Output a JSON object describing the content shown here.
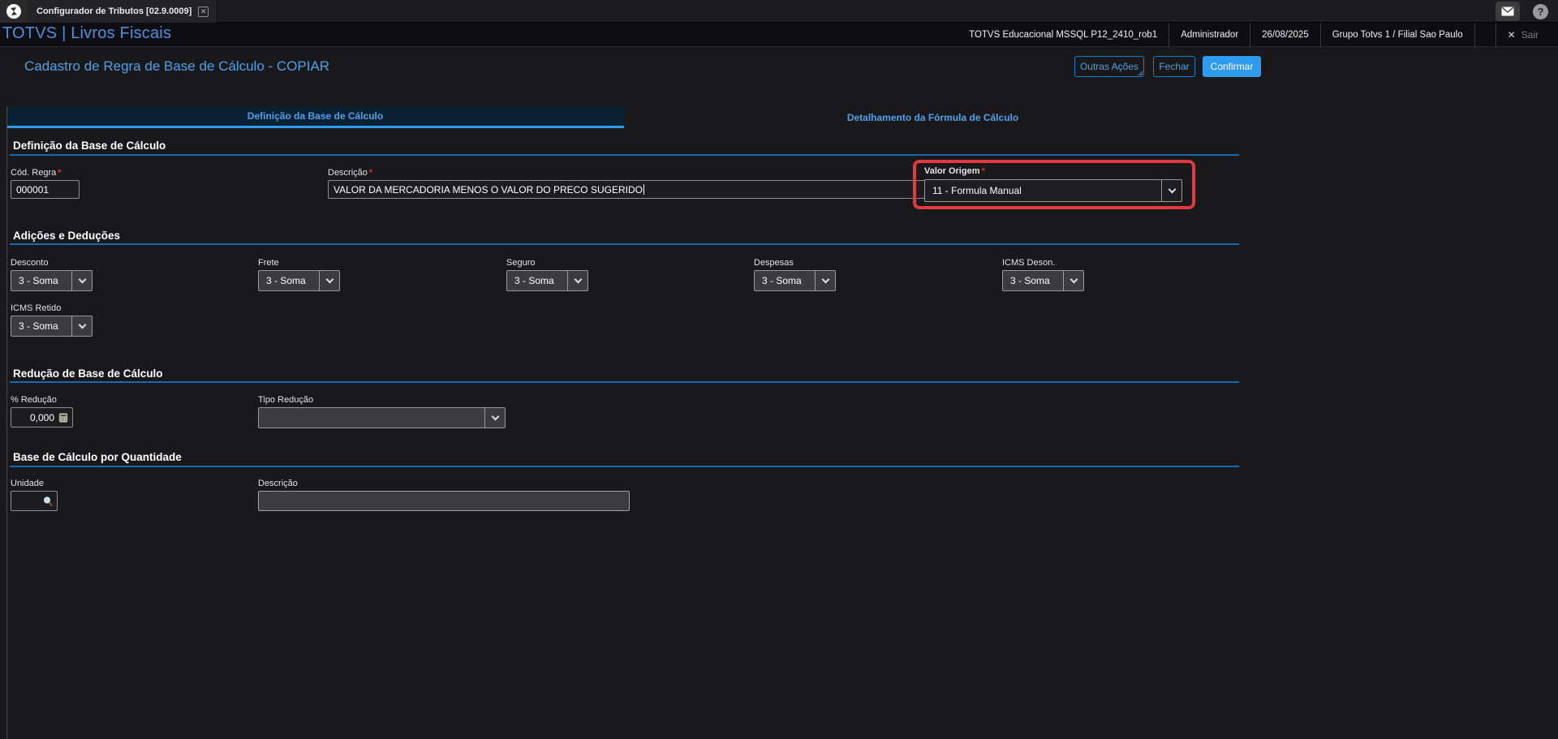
{
  "window": {
    "app_tab": "Configurador de Tributos [02.9.0009]",
    "close_glyph": "✕"
  },
  "header": {
    "brand": "TOTVS | Livros Fiscais",
    "environment": "TOTVS Educacional MSSQL P12_2410_rob1",
    "user": "Administrador",
    "date": "26/08/2025",
    "company": "Grupo Totvs 1 / Filial Sao Paulo",
    "logout_x": "✕",
    "logout_label": "Sair",
    "help_glyph": "?"
  },
  "page": {
    "title": "Cadastro de Regra de Base de Cálculo - COPIAR",
    "buttons": {
      "other_actions": "Outras Ações",
      "close": "Fechar",
      "confirm": "Confirmar"
    }
  },
  "tabs": {
    "active": "Definição da Base de Cálculo",
    "inactive": "Detalhamento da Fórmula de Cálculo"
  },
  "form": {
    "definicao": {
      "title": "Definição da Base de Cálculo",
      "cod_regra": {
        "label": "Cód. Regra",
        "required": "*",
        "value": "000001"
      },
      "descricao": {
        "label": "Descrição",
        "required": "*",
        "value": "VALOR DA MERCADORIA MENOS O VALOR DO PRECO SUGERIDO"
      },
      "valor_origem": {
        "label": "Valor Origem",
        "required": "*",
        "value": "11 - Formula Manual"
      }
    },
    "adicoes": {
      "title": "Adições e Deduções",
      "fields": [
        {
          "label": "Desconto",
          "value": "3 - Soma"
        },
        {
          "label": "Frete",
          "value": "3 - Soma"
        },
        {
          "label": "Seguro",
          "value": "3 - Soma"
        },
        {
          "label": "Despesas",
          "value": "3 - Soma"
        },
        {
          "label": "ICMS Deson.",
          "value": "3 - Soma"
        },
        {
          "label": "ICMS Retido",
          "value": "3 - Soma"
        }
      ]
    },
    "reducao": {
      "title": "Redução de Base de Cálculo",
      "pct_reducao": {
        "label": "% Redução",
        "value": "0,000"
      },
      "tipo_reducao": {
        "label": "Tipo Redução",
        "value": ""
      }
    },
    "quantidade": {
      "title": "Base de Cálculo por Quantidade",
      "unidade": {
        "label": "Unidade",
        "value": ""
      },
      "descricao": {
        "label": "Descrição",
        "value": ""
      }
    }
  },
  "colors": {
    "accent_blue": "#2e9bf0",
    "link_blue": "#4da1e8",
    "section_rule": "#176bb3",
    "highlight_red": "#e23a3e",
    "required_red": "#e03131"
  }
}
